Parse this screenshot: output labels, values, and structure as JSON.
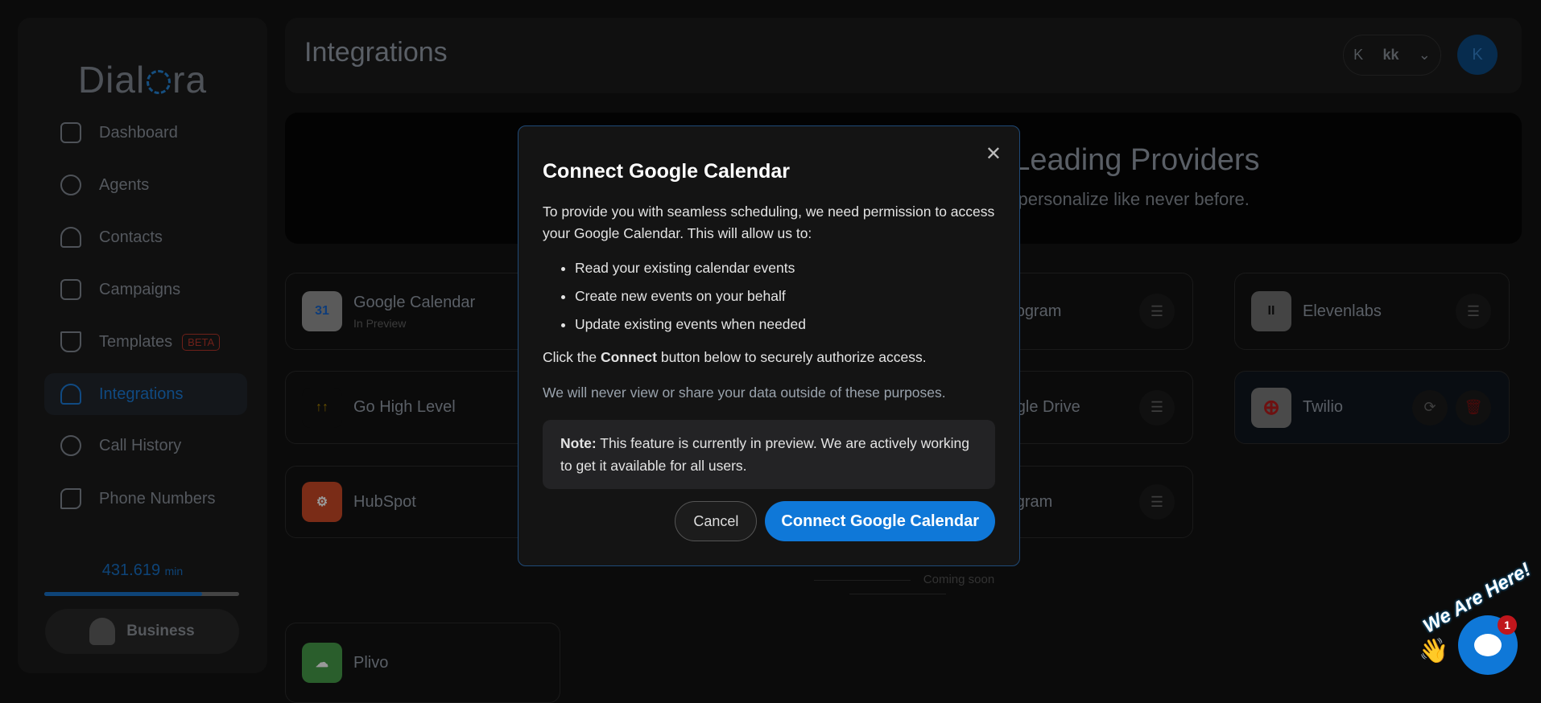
{
  "sidebar": {
    "logo": "Dialora",
    "items": [
      {
        "label": "Dashboard",
        "icon": "grid-icon"
      },
      {
        "label": "Agents",
        "icon": "headset-icon"
      },
      {
        "label": "Contacts",
        "icon": "user-icon"
      },
      {
        "label": "Campaigns",
        "icon": "calendar-icon"
      },
      {
        "label": "Templates",
        "icon": "template-icon",
        "badge": "BETA"
      },
      {
        "label": "Integrations",
        "icon": "plug-icon",
        "active": true
      },
      {
        "label": "Call History",
        "icon": "history-icon"
      },
      {
        "label": "Phone Numbers",
        "icon": "phone-icon"
      }
    ],
    "minutes_value": "431.619",
    "minutes_unit": "min",
    "minutes_progress": 0.81,
    "plan": "Business"
  },
  "header": {
    "title": "Integrations",
    "workspace_initial": "K",
    "workspace_name": "kk",
    "avatar": "K"
  },
  "banner": {
    "title": "Integrate with Leading Providers",
    "subtitle": "Automate, connect and personalize like never before."
  },
  "cards": [
    {
      "name": "Google Calendar",
      "sub": "In Preview"
    },
    {
      "name": "Deepgram"
    },
    {
      "name": "Elevenlabs"
    },
    {
      "name": "Go High Level"
    },
    {
      "name": "Google Drive"
    },
    {
      "name": "Twilio"
    },
    {
      "name": "HubSpot"
    },
    {
      "name": "Telegram"
    },
    {
      "name": "Plivo"
    }
  ],
  "coming_soon": "Coming soon",
  "modal": {
    "title": "Connect Google Calendar",
    "intro": "To provide you with seamless scheduling, we need permission to access your Google Calendar. This will allow us to:",
    "bullets": [
      "Read your existing calendar events",
      "Create new events on your behalf",
      "Update existing events when needed"
    ],
    "click_pre": "Click the ",
    "click_bold": "Connect",
    "click_post": " button below to securely authorize access.",
    "privacy": "We will never view or share your data outside of these purposes.",
    "note_label": "Note:",
    "note_text": " This feature is currently in preview. We are actively working to get it available for all users.",
    "cancel": "Cancel",
    "connect": "Connect Google Calendar"
  },
  "chat": {
    "tagline": "We Are Here!",
    "badge": "1"
  },
  "colors": {
    "accent": "#0f78d8",
    "danger": "#c0161c"
  }
}
